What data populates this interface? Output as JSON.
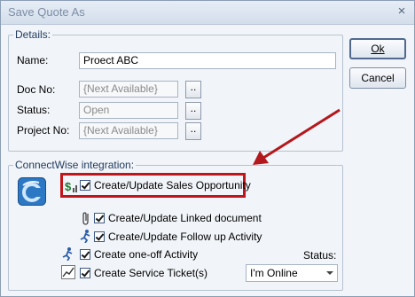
{
  "window": {
    "title": "Save Quote As",
    "close": "×"
  },
  "details": {
    "legend": "Details:",
    "name_label": "Name:",
    "name_value": "Proect ABC",
    "docno_label": "Doc No:",
    "docno_value": "{Next Available}",
    "status_label": "Status:",
    "status_value": "Open",
    "projectno_label": "Project No:",
    "projectno_value": "{Next Available}",
    "browse_label": ".."
  },
  "buttons": {
    "ok": "Ok",
    "cancel": "Cancel"
  },
  "cw": {
    "legend": "ConnectWise integration:",
    "opportunity": "Create/Update Sales Opportunity",
    "linked_doc": "Create/Update Linked document",
    "followup": "Create/Update Follow up Activity",
    "oneoff": "Create one-off Activity",
    "ticket": "Create Service Ticket(s)",
    "status_label": "Status:",
    "status_value": "I'm Online"
  },
  "colors": {
    "highlight": "#c0161b",
    "accent": "#1f3a5f"
  }
}
